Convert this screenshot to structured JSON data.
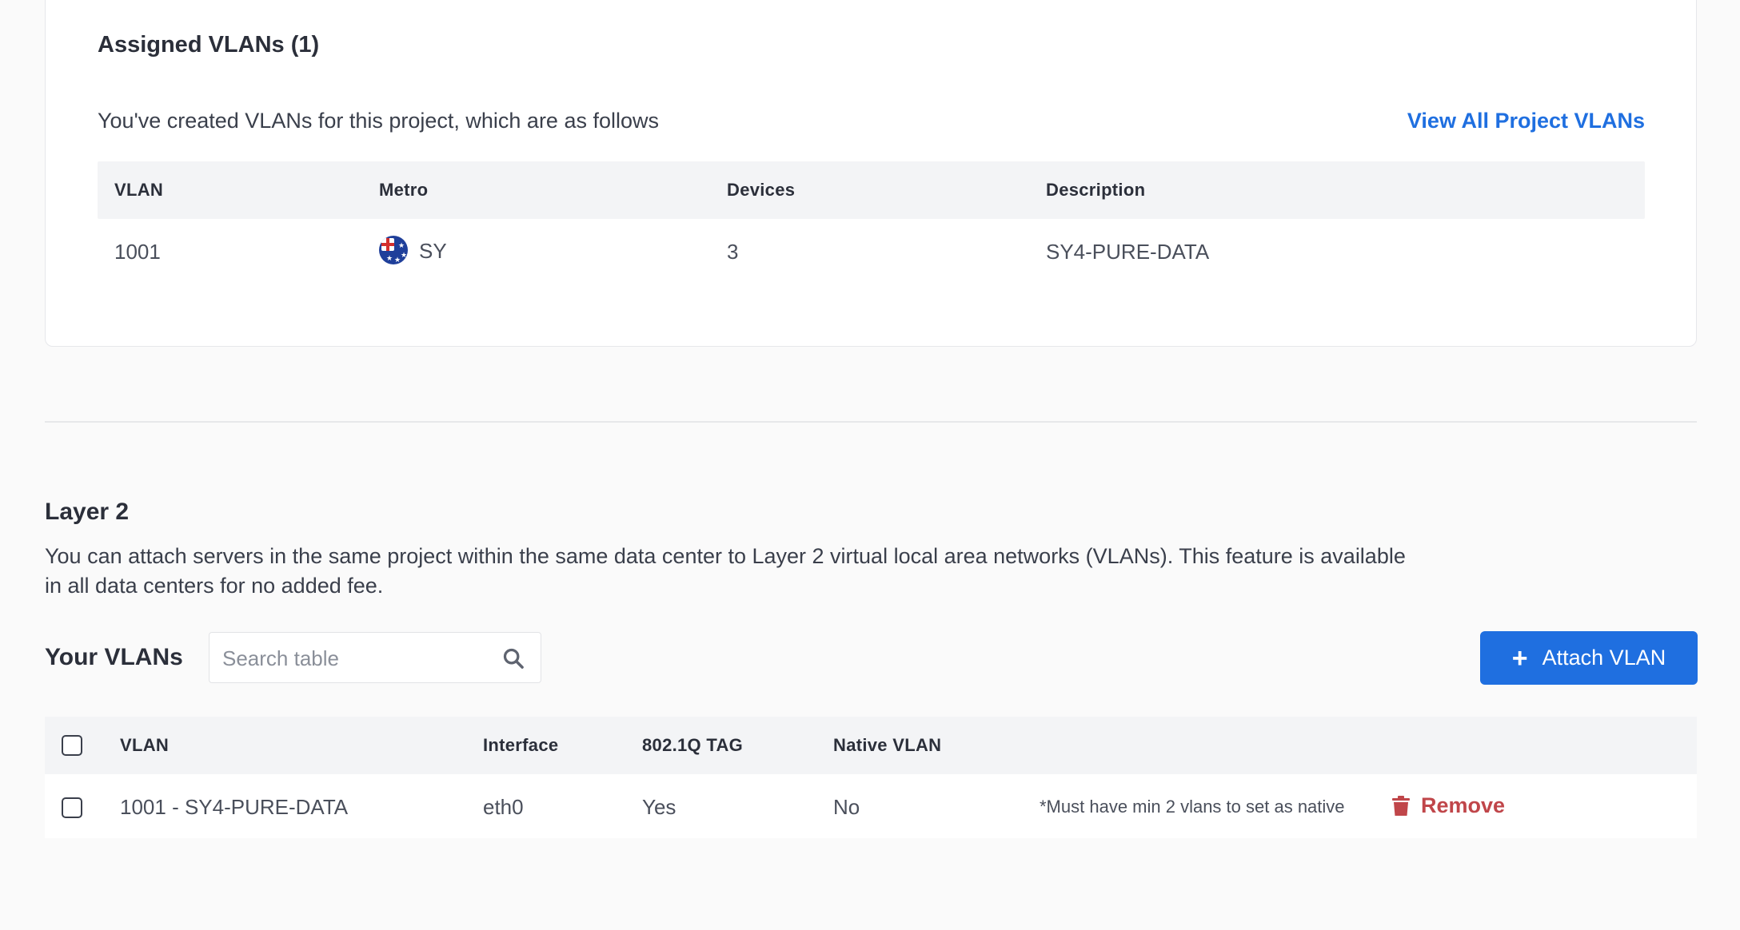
{
  "assigned": {
    "title": "Assigned VLANs (1)",
    "intro": "You've created VLANs for this project, which are as follows",
    "view_all": "View All Project VLANs",
    "columns": [
      "VLAN",
      "Metro",
      "Devices",
      "Description"
    ],
    "rows": [
      {
        "vlan": "1001",
        "metro": "SY",
        "metro_flag": "australia-flag-icon",
        "devices": "3",
        "description": "SY4-PURE-DATA"
      }
    ]
  },
  "layer2": {
    "title": "Layer 2",
    "description": "You can attach servers in the same project within the same data center to Layer 2 virtual local area networks (VLANs). This feature is available in all data centers for no added fee."
  },
  "your_vlans": {
    "title": "Your VLANs",
    "search_placeholder": "Search table",
    "search_icon": "search-icon",
    "attach_label": "Attach VLAN",
    "attach_icon": "+",
    "columns": [
      "VLAN",
      "Interface",
      "802.1Q TAG",
      "Native VLAN"
    ],
    "rows": [
      {
        "vlan": "1001 - SY4-PURE-DATA",
        "interface": "eth0",
        "tag": "Yes",
        "native": "No",
        "note": "*Must have min 2 vlans to set as native",
        "remove_label": "Remove",
        "remove_icon": "trash-icon"
      }
    ]
  },
  "colors": {
    "accent": "#1f6fe0",
    "danger": "#c0464a"
  }
}
